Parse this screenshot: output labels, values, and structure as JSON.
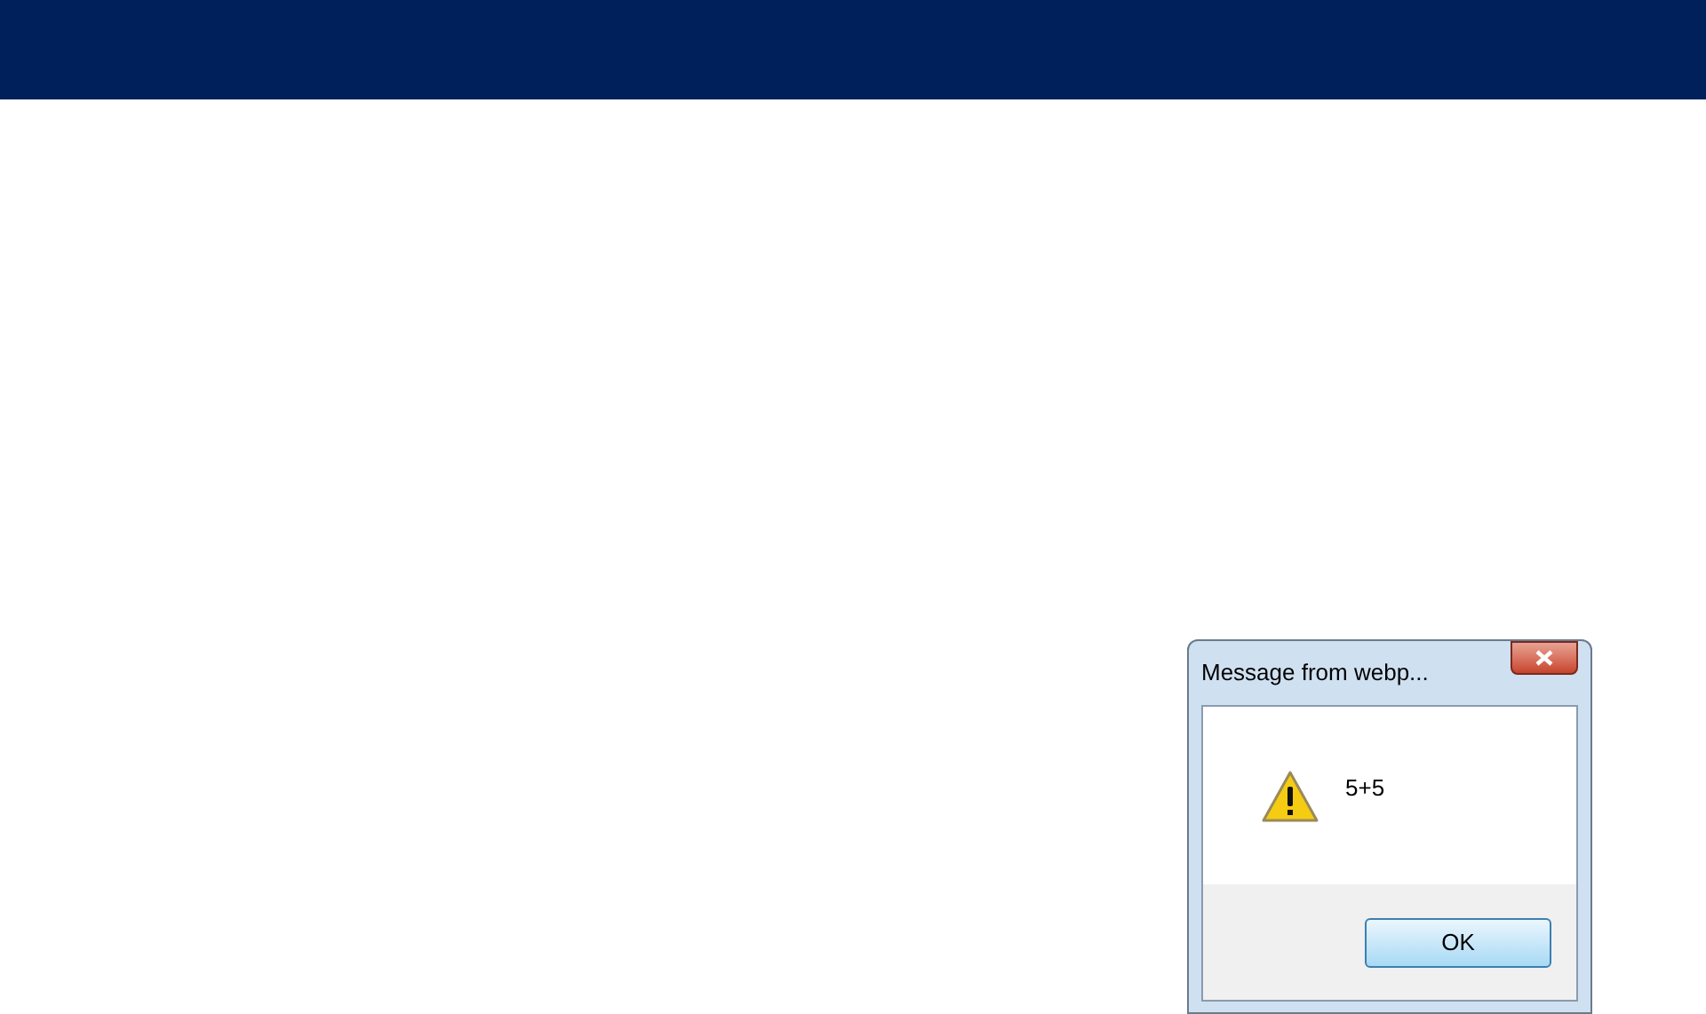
{
  "dialog": {
    "title": "Message from webp...",
    "message": "5+5",
    "buttons": [
      "OK"
    ]
  }
}
